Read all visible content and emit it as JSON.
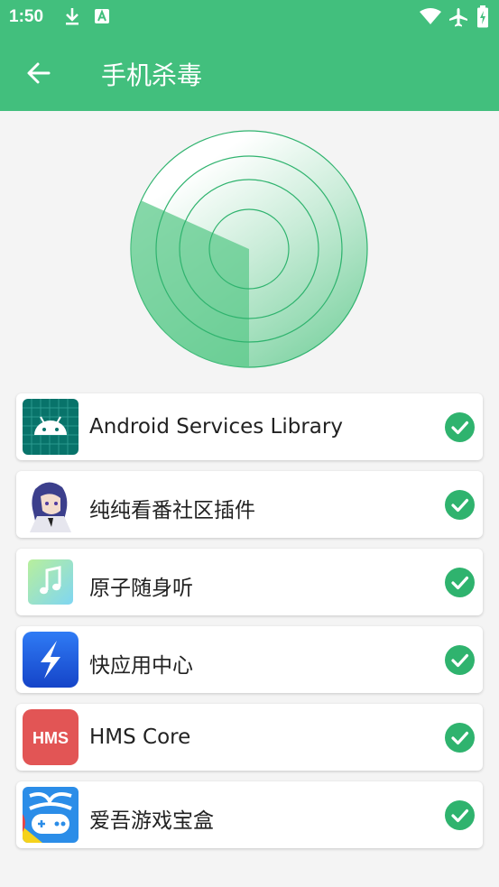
{
  "status_bar": {
    "time": "1:50",
    "left_icons": [
      "download-icon",
      "a-badge-icon"
    ],
    "right_icons": [
      "wifi-icon",
      "airplane-icon",
      "battery-charging-icon"
    ]
  },
  "app_bar": {
    "title": "手机杀毒",
    "back_icon": "arrow-back-icon",
    "color": "#42bf7d"
  },
  "scan": {
    "radar_color": "#2fb36e"
  },
  "apps": [
    {
      "name": "Android Services Library",
      "icon": "android-icon",
      "status_icon": "check-circle-icon"
    },
    {
      "name": "纯纯看番社区插件",
      "icon": "anime-avatar-icon",
      "status_icon": "check-circle-icon"
    },
    {
      "name": "原子随身听",
      "icon": "music-note-icon",
      "status_icon": "check-circle-icon"
    },
    {
      "name": "快应用中心",
      "icon": "lightning-icon",
      "status_icon": "check-circle-icon"
    },
    {
      "name": "HMS Core",
      "icon": "hms-icon",
      "icon_text": "HMS",
      "status_icon": "check-circle-icon"
    },
    {
      "name": "爱吾游戏宝盒",
      "icon": "gamepad-icon",
      "status_icon": "check-circle-icon"
    }
  ]
}
